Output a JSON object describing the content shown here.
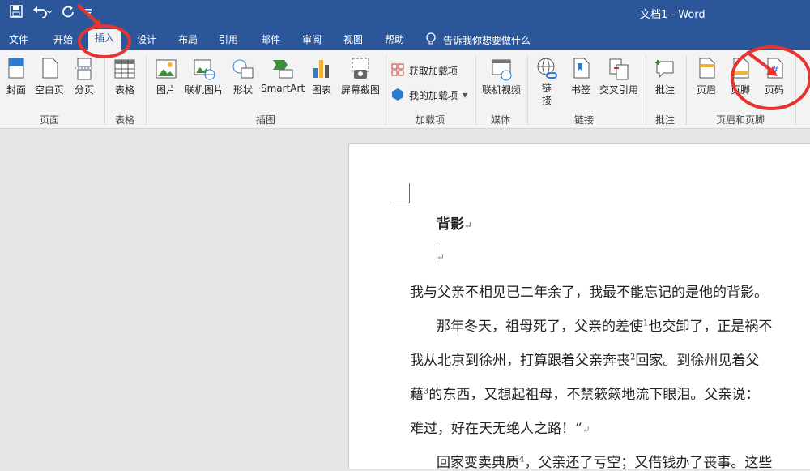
{
  "window": {
    "title": "文档1 - Word"
  },
  "qat": {
    "save_icon": "save-icon",
    "undo_icon": "undo-icon",
    "redo_icon": "redo-icon",
    "customize_icon": "customize-icon"
  },
  "tabs": [
    {
      "label": "文件"
    },
    {
      "label": "开始"
    },
    {
      "label": "插入"
    },
    {
      "label": "设计"
    },
    {
      "label": "布局"
    },
    {
      "label": "引用"
    },
    {
      "label": "邮件"
    },
    {
      "label": "审阅"
    },
    {
      "label": "视图"
    },
    {
      "label": "帮助"
    }
  ],
  "active_tab": "插入",
  "tellme": {
    "text": "告诉我你想要做什么"
  },
  "ribbon": {
    "page": {
      "label": "页面",
      "buttons": [
        "封面",
        "空白页",
        "分页"
      ]
    },
    "tables": {
      "label": "表格",
      "buttons": [
        "表格"
      ]
    },
    "illustrations": {
      "label": "插图",
      "buttons": [
        "图片",
        "联机图片",
        "形状",
        "SmartArt",
        "图表",
        "屏幕截图"
      ]
    },
    "addins": {
      "label": "加载项",
      "buttons": [
        "获取加载项",
        "我的加载项"
      ]
    },
    "media": {
      "label": "媒体",
      "buttons": [
        "联机视频"
      ]
    },
    "links": {
      "label": "链接",
      "buttons": [
        "链\n接",
        "书签",
        "交叉引用"
      ]
    },
    "comments": {
      "label": "批注",
      "buttons": [
        "批注"
      ]
    },
    "headerfooter": {
      "label": "页眉和页脚",
      "buttons": [
        "页眉",
        "页脚",
        "页码"
      ]
    }
  },
  "document": {
    "title": "背影",
    "lines": [
      "我与父亲不相见已二年余了，我最不能忘记的是他的背影。",
      "那年冬天，祖母死了，父亲的差使",
      "也交卸了，正是祸不",
      "我从北京到徐州，打算跟着父亲奔丧",
      "回家。到徐州见着父",
      "藉",
      "的东西，又想起祖母，不禁簌簌地流下眼泪。父亲说：",
      "难过，好在天无绝人之路！”",
      "回家变卖典质",
      "，父亲还了亏空；又借钱办了丧事。这些"
    ],
    "footnotes": [
      "1",
      "2",
      "3",
      "4"
    ]
  },
  "colors": {
    "brand": "#2b579a",
    "highlight": "#e8342e"
  }
}
